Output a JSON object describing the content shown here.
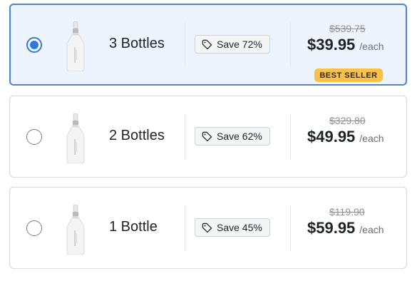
{
  "offers": [
    {
      "quantity_label": "3 Bottles",
      "selected": true,
      "save_label": "Save 72%",
      "original_price": "$539.75",
      "price": "$39.95",
      "per_unit": "/each",
      "badge": "BEST SELLER"
    },
    {
      "quantity_label": "2 Bottles",
      "selected": false,
      "save_label": "Save 62%",
      "original_price": "$329.80",
      "price": "$49.95",
      "per_unit": "/each"
    },
    {
      "quantity_label": "1 Bottle",
      "selected": false,
      "save_label": "Save 45%",
      "original_price": "$119.90",
      "price": "$59.95",
      "per_unit": "/each"
    }
  ],
  "icons": {
    "product": "serum-bottle-icon",
    "save": "tag-icon"
  },
  "colors": {
    "selected_border": "#4a86d8",
    "selected_background": "#eef4fe",
    "radio_selected": "#2f7ae0",
    "badge_background": "#f7c14d"
  }
}
